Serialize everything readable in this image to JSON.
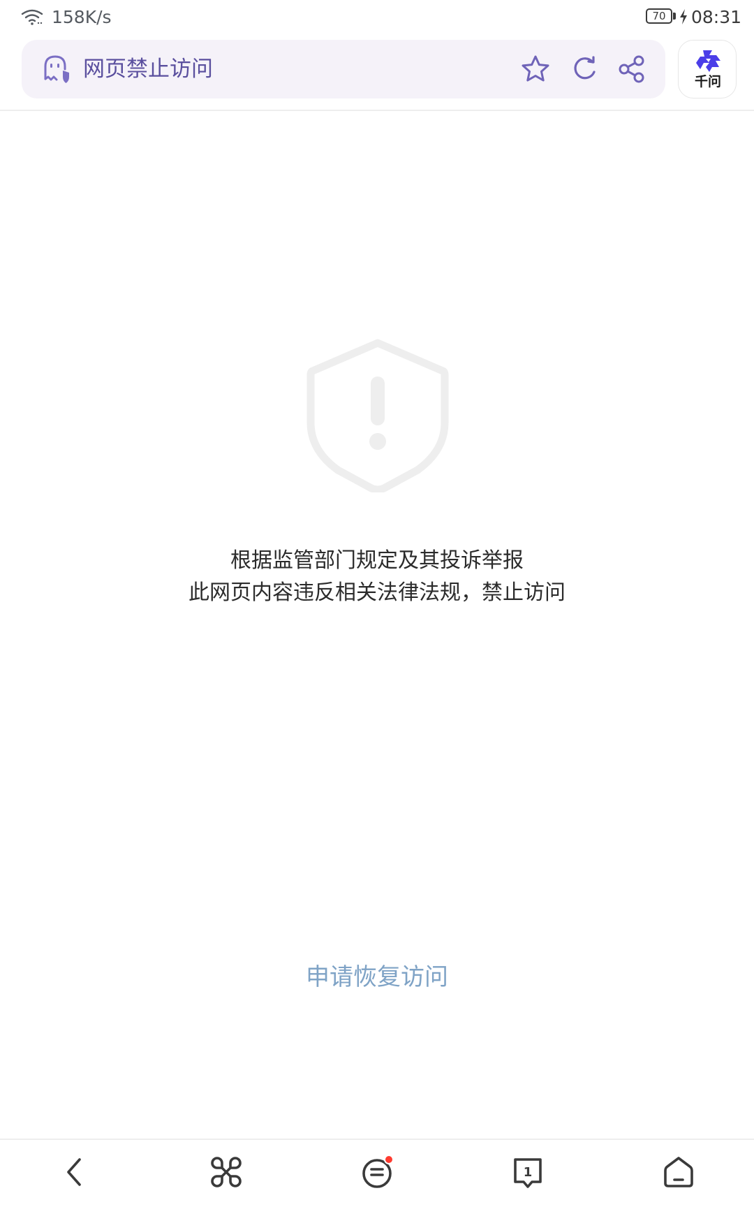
{
  "status_bar": {
    "network_speed": "158K/s",
    "battery_level": "70",
    "time": "08:31",
    "icons": [
      "wifi-icon",
      "charging-icon"
    ]
  },
  "address_bar": {
    "site_icon": "ghost-shield-icon",
    "title": "网页禁止访问",
    "actions": [
      "star-icon",
      "refresh-icon",
      "share-icon"
    ],
    "accent_color": "#5a4f9e",
    "background_color": "#f5f2f9"
  },
  "qianwen": {
    "label": "千问",
    "icon": "qianwen-logo-icon",
    "color": "#4b3ee8"
  },
  "main": {
    "icon": "warning-shield-icon",
    "message_line1": "根据监管部门规定及其投诉举报",
    "message_line2": "此网页内容违反相关法律法规，禁止访问",
    "restore_link": "申请恢复访问",
    "link_color": "#7fa3c6"
  },
  "bottom_nav": {
    "items": [
      "back-icon",
      "command-menu-icon",
      "feed-icon",
      "tabs-icon",
      "home-icon"
    ],
    "tab_count": "1",
    "badge_color": "#ff3b30"
  }
}
